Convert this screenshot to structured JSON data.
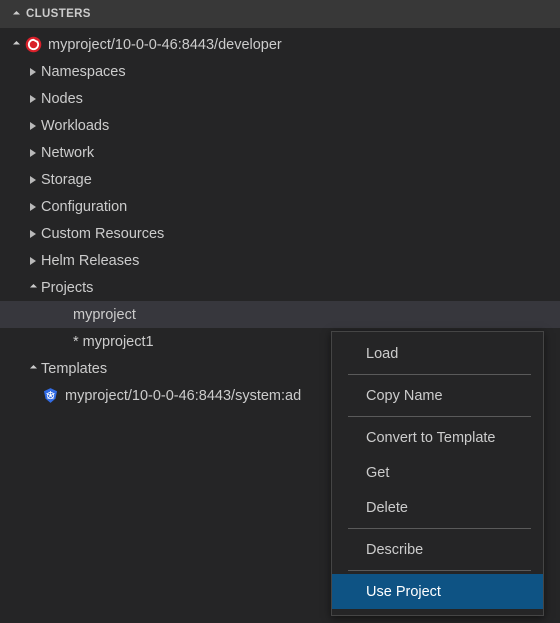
{
  "section": {
    "title": "CLUSTERS",
    "twisty_icon": "chevron-down-icon"
  },
  "tree": {
    "items": [
      {
        "label": "myproject/10-0-0-46:8443/developer",
        "twisty": "expanded",
        "icon": "openshift-icon",
        "indent": 0,
        "selected": false
      },
      {
        "label": "Namespaces",
        "twisty": "collapsed",
        "icon": "",
        "indent": 1,
        "selected": false
      },
      {
        "label": "Nodes",
        "twisty": "collapsed",
        "icon": "",
        "indent": 1,
        "selected": false
      },
      {
        "label": "Workloads",
        "twisty": "collapsed",
        "icon": "",
        "indent": 1,
        "selected": false
      },
      {
        "label": "Network",
        "twisty": "collapsed",
        "icon": "",
        "indent": 1,
        "selected": false
      },
      {
        "label": "Storage",
        "twisty": "collapsed",
        "icon": "",
        "indent": 1,
        "selected": false
      },
      {
        "label": "Configuration",
        "twisty": "collapsed",
        "icon": "",
        "indent": 1,
        "selected": false
      },
      {
        "label": "Custom Resources",
        "twisty": "collapsed",
        "icon": "",
        "indent": 1,
        "selected": false
      },
      {
        "label": "Helm Releases",
        "twisty": "collapsed",
        "icon": "",
        "indent": 1,
        "selected": false
      },
      {
        "label": "Projects",
        "twisty": "expanded",
        "icon": "",
        "indent": 1,
        "selected": false
      },
      {
        "label": "myproject",
        "twisty": "none",
        "icon": "",
        "indent": 3,
        "selected": true
      },
      {
        "label": "* myproject1",
        "twisty": "none",
        "icon": "",
        "indent": 3,
        "selected": false
      },
      {
        "label": "Templates",
        "twisty": "expanded",
        "icon": "",
        "indent": 1,
        "selected": false
      },
      {
        "label": "myproject/10-0-0-46:8443/system:ad",
        "twisty": "none",
        "icon": "kubernetes-icon",
        "indent": 1,
        "selected": false
      }
    ]
  },
  "context_menu": {
    "entries": [
      {
        "type": "item",
        "label": "Load",
        "highlighted": false
      },
      {
        "type": "separator"
      },
      {
        "type": "item",
        "label": "Copy Name",
        "highlighted": false
      },
      {
        "type": "separator"
      },
      {
        "type": "item",
        "label": "Convert to Template",
        "highlighted": false
      },
      {
        "type": "item",
        "label": "Get",
        "highlighted": false
      },
      {
        "type": "item",
        "label": "Delete",
        "highlighted": false
      },
      {
        "type": "separator"
      },
      {
        "type": "item",
        "label": "Describe",
        "highlighted": false
      },
      {
        "type": "separator"
      },
      {
        "type": "item",
        "label": "Use Project",
        "highlighted": true
      }
    ]
  },
  "colors": {
    "background": "#252526",
    "header_background": "#383838",
    "selected_row": "#37373d",
    "menu_highlight": "#0e5384",
    "openshift_red": "#d9202a",
    "kubernetes_blue": "#326ce5",
    "text": "#cccccc"
  }
}
